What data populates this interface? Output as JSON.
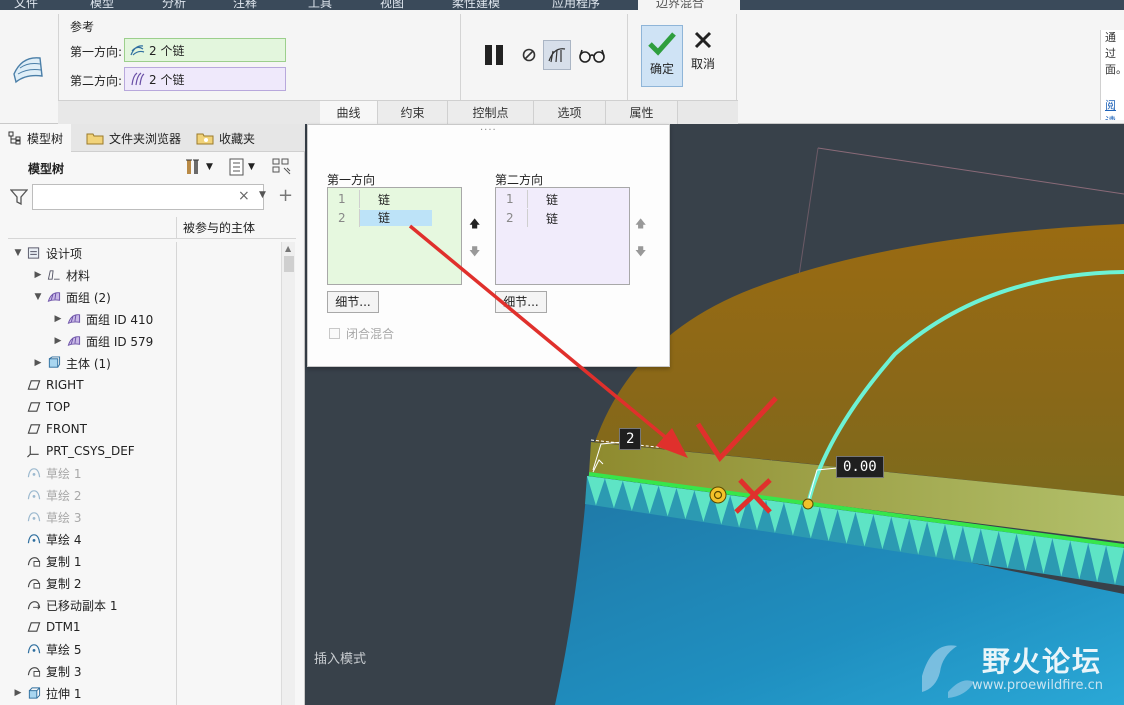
{
  "menubar": {
    "tabs": [
      "文件",
      "模型",
      "分析",
      "注释",
      "工具",
      "视图",
      "柔性建模",
      "应用程序"
    ],
    "active_tab": "边界混合"
  },
  "ribbon": {
    "references_title": "参考",
    "first_direction_label": "第一方向:",
    "first_direction_value": "2 个链",
    "second_direction_label": "第二方向:",
    "second_direction_value": "2 个链",
    "ok_label": "确定",
    "cancel_label": "取消",
    "tabs": [
      "曲线",
      "约束",
      "控制点",
      "选项",
      "属性"
    ],
    "help_text_1": "通过",
    "help_text_2": "面。",
    "help_link": "阅读"
  },
  "left_panel": {
    "tabs": [
      "模型树",
      "文件夹浏览器",
      "收藏夹"
    ],
    "title": "模型树",
    "filter_placeholder": "",
    "column_header": "被参与的主体",
    "tree": [
      {
        "label": "设计项",
        "icon": "design-items-icon",
        "indent": 0,
        "arrow": "▼",
        "dim": false
      },
      {
        "label": "材料",
        "icon": "material-icon",
        "indent": 1,
        "arrow": "▶",
        "dim": false
      },
      {
        "label": "面组 (2)",
        "icon": "quilt-icon",
        "indent": 1,
        "arrow": "▼",
        "dim": false
      },
      {
        "label": "面组 ID 410",
        "icon": "quilt-icon",
        "indent": 2,
        "arrow": "▶",
        "dim": false
      },
      {
        "label": "面组 ID 579",
        "icon": "quilt-icon",
        "indent": 2,
        "arrow": "▶",
        "dim": false
      },
      {
        "label": "主体 (1)",
        "icon": "body-icon",
        "indent": 1,
        "arrow": "▶",
        "dim": false
      },
      {
        "label": "RIGHT",
        "icon": "datum-plane-icon",
        "indent": 0,
        "arrow": "",
        "dim": false
      },
      {
        "label": "TOP",
        "icon": "datum-plane-icon",
        "indent": 0,
        "arrow": "",
        "dim": false
      },
      {
        "label": "FRONT",
        "icon": "datum-plane-icon",
        "indent": 0,
        "arrow": "",
        "dim": false
      },
      {
        "label": "PRT_CSYS_DEF",
        "icon": "csys-icon",
        "indent": 0,
        "arrow": "",
        "dim": false
      },
      {
        "label": "草绘 1",
        "icon": "sketch-icon",
        "indent": 0,
        "arrow": "",
        "dim": true
      },
      {
        "label": "草绘 2",
        "icon": "sketch-icon",
        "indent": 0,
        "arrow": "",
        "dim": true
      },
      {
        "label": "草绘 3",
        "icon": "sketch-icon",
        "indent": 0,
        "arrow": "",
        "dim": true
      },
      {
        "label": "草绘 4",
        "icon": "sketch-icon",
        "indent": 0,
        "arrow": "",
        "dim": false
      },
      {
        "label": "复制 1",
        "icon": "copy-icon",
        "indent": 0,
        "arrow": "",
        "dim": false
      },
      {
        "label": "复制 2",
        "icon": "copy-icon",
        "indent": 0,
        "arrow": "",
        "dim": false
      },
      {
        "label": "已移动副本 1",
        "icon": "moved-copy-icon",
        "indent": 0,
        "arrow": "",
        "dim": false
      },
      {
        "label": "DTM1",
        "icon": "datum-plane-icon",
        "indent": 0,
        "arrow": "",
        "dim": false
      },
      {
        "label": "草绘 5",
        "icon": "sketch-icon",
        "indent": 0,
        "arrow": "",
        "dim": false
      },
      {
        "label": "复制 3",
        "icon": "copy-icon",
        "indent": 0,
        "arrow": "",
        "dim": false
      },
      {
        "label": "拉伸 1",
        "icon": "extrude-icon",
        "indent": 0,
        "arrow": "▶",
        "dim": false
      }
    ]
  },
  "curves_panel": {
    "first_direction_title": "第一方向",
    "second_direction_title": "第二方向",
    "first_rows": [
      {
        "n": "1",
        "v": "链"
      },
      {
        "n": "2",
        "v": "链"
      }
    ],
    "second_rows": [
      {
        "n": "1",
        "v": "链"
      },
      {
        "n": "2",
        "v": "链"
      }
    ],
    "details_label": "细节...",
    "closed_blend_label": "闭合混合"
  },
  "viewport": {
    "mode_text": "插入模式",
    "dim_label_1": "2",
    "dim_label_2": "0.00",
    "watermark_title": "野火论坛",
    "watermark_url": "www.proewildfire.cn"
  },
  "colors": {
    "accent_ok": "#2e9e3e",
    "annotation_red": "#e0302c",
    "viewport_bg": "#38414a"
  }
}
